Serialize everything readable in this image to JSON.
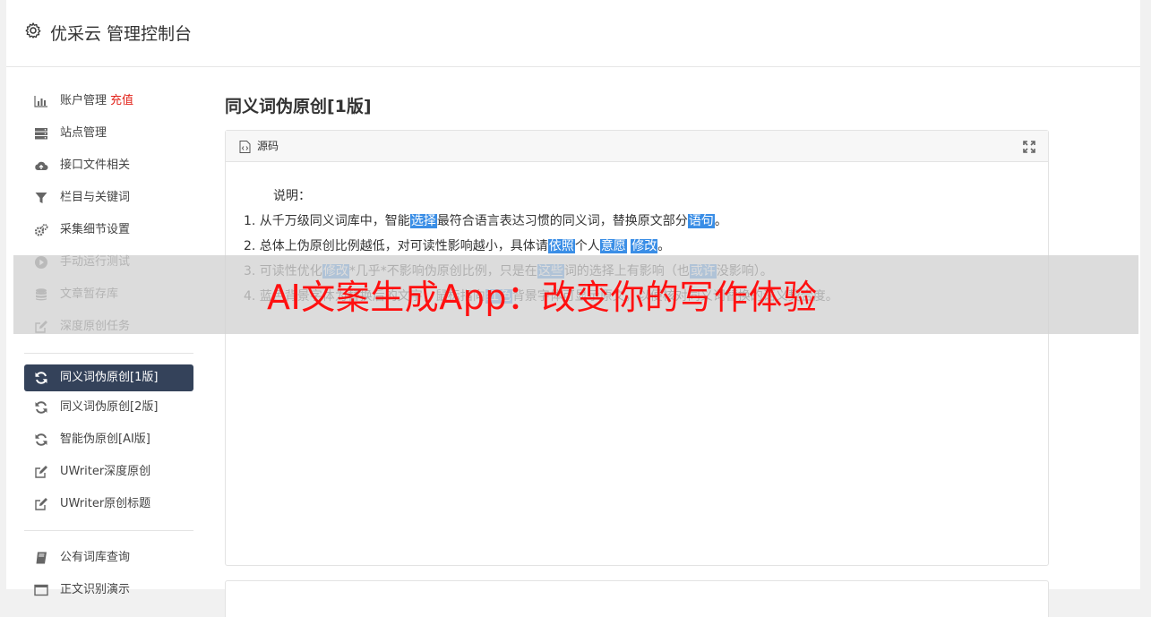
{
  "header": {
    "title": "优采云 管理控制台",
    "gear_icon": "gear-icon"
  },
  "sidebar": {
    "group1": [
      {
        "label": "账户管理",
        "badge": "充值",
        "icon": "bar-chart-icon"
      },
      {
        "label": "站点管理",
        "icon": "server-icon"
      },
      {
        "label": "接口文件相关",
        "icon": "cloud-upload-icon"
      },
      {
        "label": "栏目与关键词",
        "icon": "filter-icon"
      },
      {
        "label": "采集细节设置",
        "icon": "gears-icon"
      },
      {
        "label": "手动运行测试",
        "icon": "play-circle-icon"
      },
      {
        "label": "文章暂存库",
        "icon": "database-icon"
      },
      {
        "label": "深度原创任务",
        "icon": "edit-icon"
      }
    ],
    "group2": [
      {
        "label": "同义词伪原创[1版]",
        "icon": "refresh-icon",
        "active": true
      },
      {
        "label": "同义词伪原创[2版]",
        "icon": "refresh-icon"
      },
      {
        "label": "智能伪原创[AI版]",
        "icon": "refresh-icon"
      },
      {
        "label": "UWriter深度原创",
        "icon": "edit-icon"
      },
      {
        "label": "UWriter原创标题",
        "icon": "edit-icon"
      }
    ],
    "group3": [
      {
        "label": "公有词库查询",
        "icon": "book-icon"
      },
      {
        "label": "正文识别演示",
        "icon": "window-icon"
      }
    ]
  },
  "content": {
    "page_title": "同义词伪原创[1版]",
    "panel": {
      "label": "源码",
      "code_icon": "file-code-icon",
      "expand_icon": "expand-icon",
      "intro": "说明：",
      "lines": [
        [
          {
            "t": "1. 从千万级同义词库中，智能"
          },
          {
            "t": "选择",
            "h": true
          },
          {
            "t": "最符合语言表达习惯的同义词，替换原文部分"
          },
          {
            "t": "语句",
            "h": true
          },
          {
            "t": "。"
          }
        ],
        [
          {
            "t": "2. 总体上伪原创比例越低，对可读性影响越小，具体请"
          },
          {
            "t": "依照",
            "h": true
          },
          {
            "t": "个人"
          },
          {
            "t": "意愿",
            "h": true
          },
          {
            "t": " "
          },
          {
            "t": "修改",
            "h": true
          },
          {
            "t": "。"
          }
        ],
        [
          {
            "t": "3. 可读性优化"
          },
          {
            "t": "修改",
            "h": true
          },
          {
            "t": "*几乎*不影响伪原创比例，只是在"
          },
          {
            "t": "这些",
            "h": true
          },
          {
            "t": "词的选择上有影响（也"
          },
          {
            "t": "或许",
            "h": true
          },
          {
            "t": "没影响）。"
          }
        ],
        [
          {
            "t": "4. 蓝色背景字体为替换后的文字，鼠标指向"
          },
          {
            "t": "红色",
            "h": true
          },
          {
            "t": "背景字体可显示原文，以便核对同义词替换的语义契合度。"
          }
        ]
      ]
    }
  },
  "overlay": {
    "text": "AI文案生成App：改变你的写作体验"
  }
}
